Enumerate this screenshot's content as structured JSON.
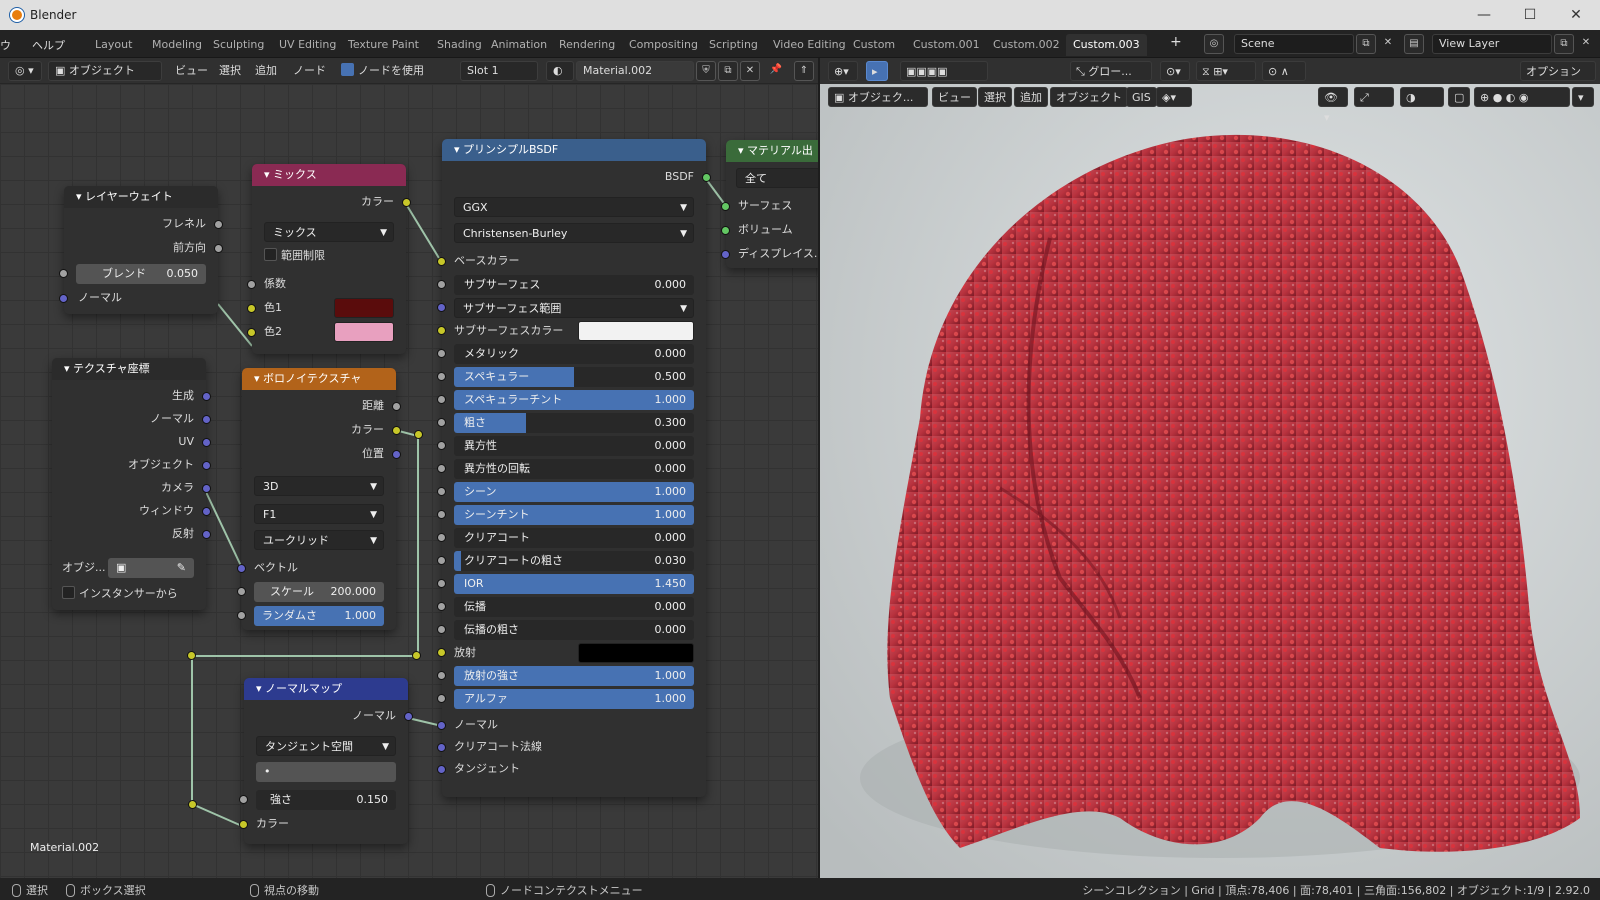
{
  "window": {
    "title": "Blender",
    "minimize": "—",
    "maximize": "☐",
    "close": "✕"
  },
  "menubar": {
    "items": [
      "ウ",
      "ヘルプ"
    ]
  },
  "workspaces": {
    "tabs": [
      "Layout",
      "Modeling",
      "Sculpting",
      "UV Editing",
      "Texture Paint",
      "Shading",
      "Animation",
      "Rendering",
      "Compositing",
      "Scripting",
      "Video Editing",
      "Custom",
      "Custom.001",
      "Custom.002",
      "Custom.003"
    ],
    "active": "Custom.003",
    "add": "+"
  },
  "scene": {
    "name": "Scene",
    "view_layer": "View Layer"
  },
  "node_header": {
    "mode": "オブジェクト",
    "menus": [
      "ビュー",
      "選択",
      "追加",
      "ノード"
    ],
    "use_nodes_label": "ノードを使用",
    "slot": "Slot 1",
    "material": "Material.002"
  },
  "material_label": "Material.002",
  "nodes": {
    "layer_weight": {
      "title": "レイヤーウェイト",
      "out_fresnel": "フレネル",
      "out_facing": "前方向",
      "blend_label": "ブレンド",
      "blend_value": "0.050",
      "normal": "ノーマル"
    },
    "mix": {
      "title": "ミックス",
      "out_color": "カラー",
      "blend_type": "ミックス",
      "clamp": "範囲制限",
      "factor": "係数",
      "color1": "色1",
      "color2": "色2",
      "color1_hex": "#5a0c0c",
      "color2_hex": "#e8a0bf"
    },
    "tex_coord": {
      "title": "テクスチャ座標",
      "outputs": [
        "生成",
        "ノーマル",
        "UV",
        "オブジェクト",
        "カメラ",
        "ウィンドウ",
        "反射"
      ],
      "object_label": "オブジ...",
      "from_instancer": "インスタンサーから"
    },
    "voronoi": {
      "title": "ボロノイテクスチャ",
      "out_distance": "距離",
      "out_color": "カラー",
      "out_position": "位置",
      "dimension": "3D",
      "feature": "F1",
      "metric": "ユークリッド",
      "vector": "ベクトル",
      "scale_label": "スケール",
      "scale_value": "200.000",
      "random_label": "ランダムさ",
      "random_value": "1.000"
    },
    "normal_map": {
      "title": "ノーマルマップ",
      "out_normal": "ノーマル",
      "space": "タンジェント空間",
      "uv": "•",
      "strength_label": "強さ",
      "strength_value": "0.150",
      "color": "カラー"
    },
    "principled": {
      "title": "プリンシプルBSDF",
      "out": "BSDF",
      "distribution": "GGX",
      "subsurface_method": "Christensen-Burley",
      "base_color": "ベースカラー",
      "fields": [
        {
          "label": "サブサーフェス",
          "value": "0.000",
          "fill": 0
        },
        {
          "label": "サブサーフェス範囲",
          "value": "",
          "fill": 0,
          "dropdown": true
        },
        {
          "label": "サブサーフェスカラー",
          "value": "",
          "fill": 0,
          "swatch": "#f2f2f2"
        },
        {
          "label": "メタリック",
          "value": "0.000",
          "fill": 0
        },
        {
          "label": "スペキュラー",
          "value": "0.500",
          "fill": 0.5
        },
        {
          "label": "スペキュラーチント",
          "value": "1.000",
          "fill": 1
        },
        {
          "label": "粗さ",
          "value": "0.300",
          "fill": 0.3
        },
        {
          "label": "異方性",
          "value": "0.000",
          "fill": 0
        },
        {
          "label": "異方性の回転",
          "value": "0.000",
          "fill": 0
        },
        {
          "label": "シーン",
          "value": "1.000",
          "fill": 1
        },
        {
          "label": "シーンチント",
          "value": "1.000",
          "fill": 1
        },
        {
          "label": "クリアコート",
          "value": "0.000",
          "fill": 0
        },
        {
          "label": "クリアコートの粗さ",
          "value": "0.030",
          "fill": 0.03
        },
        {
          "label": "IOR",
          "value": "1.450",
          "fill": 1
        },
        {
          "label": "伝播",
          "value": "0.000",
          "fill": 0
        },
        {
          "label": "伝播の粗さ",
          "value": "0.000",
          "fill": 0
        },
        {
          "label": "放射",
          "value": "",
          "fill": 0,
          "swatch": "#000000"
        },
        {
          "label": "放射の強さ",
          "value": "1.000",
          "fill": 1
        },
        {
          "label": "アルファ",
          "value": "1.000",
          "fill": 1
        }
      ],
      "normal": "ノーマル",
      "clearcoat_normal": "クリアコート法線",
      "tangent": "タンジェント"
    },
    "material_output": {
      "title": "マテリアル出",
      "target": "全て",
      "surface": "サーフェス",
      "volume": "ボリューム",
      "displacement": "ディスプレイス..."
    }
  },
  "viewport_header": {
    "transform": "グロー...",
    "options": "オプション",
    "mode": "オブジェク...",
    "menus": [
      "ビュー",
      "選択",
      "追加",
      "オブジェクト",
      "GIS"
    ]
  },
  "statusbar": {
    "select": "選択",
    "box_select": "ボックス選択",
    "move_view": "視点の移動",
    "node_context": "ノードコンテクストメニュー",
    "stats": "シーンコレクション | Grid | 頂点:78,406 | 面:78,401 | 三角面:156,802 | オブジェクト:1/9 | 2.92.0"
  }
}
